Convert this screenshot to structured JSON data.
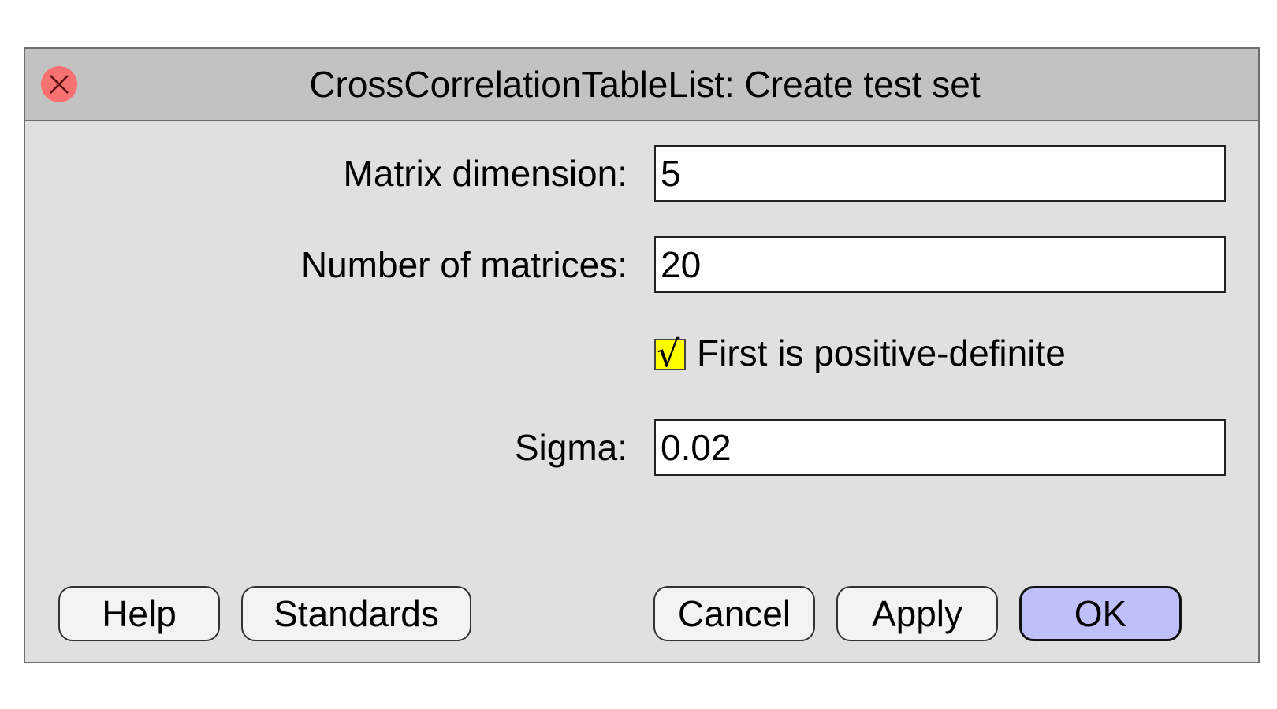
{
  "window": {
    "title": "CrossCorrelationTableList: Create test set",
    "close_icon": "close-icon"
  },
  "form": {
    "matrix_dimension": {
      "label": "Matrix dimension:",
      "value": "5"
    },
    "number_of_matrices": {
      "label": "Number of matrices:",
      "value": "20"
    },
    "first_positive_definite": {
      "label": "First is positive-definite",
      "checked": true,
      "mark": "√"
    },
    "sigma": {
      "label": "Sigma:",
      "value": "0.02"
    }
  },
  "buttons": {
    "help": "Help",
    "standards": "Standards",
    "cancel": "Cancel",
    "apply": "Apply",
    "ok": "OK"
  },
  "colors": {
    "dialog_bg": "#e0e0e0",
    "titlebar_bg": "#c2c2c2",
    "close_button": "#f87171",
    "checkbox_bg": "#ffff00",
    "default_button_bg": "#bfbffb"
  }
}
